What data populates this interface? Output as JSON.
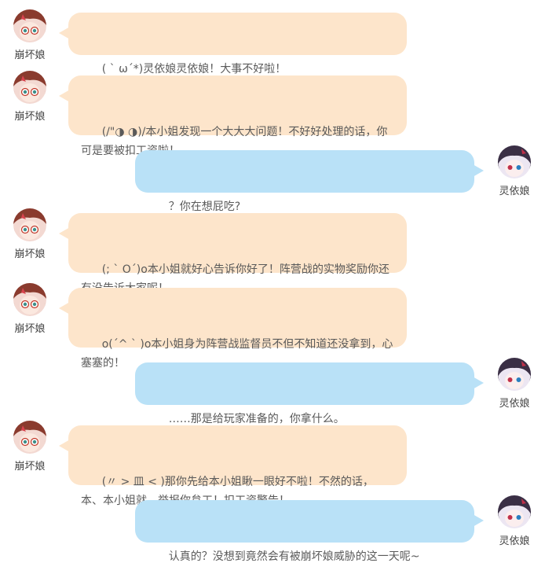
{
  "colors": {
    "left_bubble": "#fde5cb",
    "right_bubble": "#b9e1f7",
    "text": "#5a5a5a"
  },
  "messages": [
    {
      "side": "left",
      "sender": "崩坏娘",
      "avatar": "honkai-girl-avatar",
      "text": "( ` ω´*)灵依娘灵依娘！大事不好啦！"
    },
    {
      "side": "left",
      "sender": "崩坏娘",
      "avatar": "honkai-girl-avatar",
      "text": "(/\"◑ ◑)/本小姐发现一个大大大问题！不好好处理的话，你可是要被扣工资啦！"
    },
    {
      "side": "right",
      "sender": "灵依娘",
      "avatar": "lingyi-girl-avatar",
      "text": "？你在想屁吃?"
    },
    {
      "side": "left",
      "sender": "崩坏娘",
      "avatar": "honkai-girl-avatar",
      "text": "(; ` O´)o本小姐就好心告诉你好了！阵营战的实物奖励你还有没告诉大家呢！"
    },
    {
      "side": "left",
      "sender": "崩坏娘",
      "avatar": "honkai-girl-avatar",
      "text": "o(´^ ` )o本小姐身为阵营战监督员不但不知道还没拿到，心塞塞的！"
    },
    {
      "side": "right",
      "sender": "灵依娘",
      "avatar": "lingyi-girl-avatar",
      "text": "……那是给玩家准备的，你拿什么。"
    },
    {
      "side": "left",
      "sender": "崩坏娘",
      "avatar": "honkai-girl-avatar",
      "text": "(〃 > 皿 < )那你先给本小姐瞅一眼好不啦！不然的话，本、本小姐就，举报你怠工！扣工资警告！"
    },
    {
      "side": "right",
      "sender": "灵依娘",
      "avatar": "lingyi-girl-avatar",
      "text": "认真的？没想到竟然会有被崩坏娘威胁的这一天呢~"
    }
  ]
}
